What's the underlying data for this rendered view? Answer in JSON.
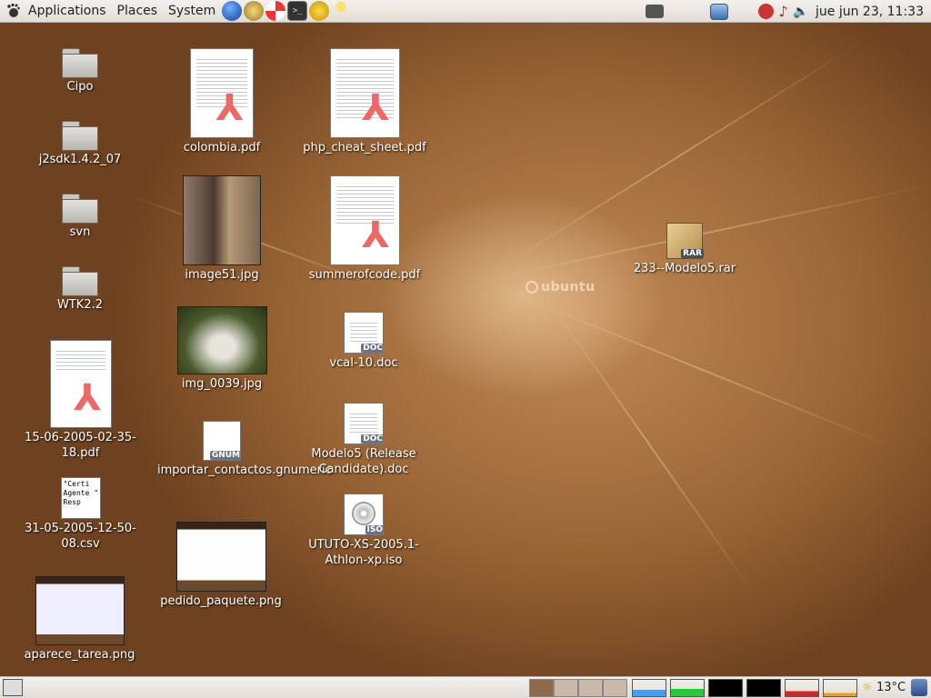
{
  "top_panel": {
    "menus": [
      "Applications",
      "Places",
      "System"
    ],
    "launchers": [
      "globe-icon",
      "network-icon",
      "help-icon",
      "terminal-icon",
      "messenger-icon",
      "gaim-icon"
    ],
    "tray_icons": [
      "screenshot-icon",
      "monitor-icon",
      "stop-icon",
      "music-icon",
      "volume-icon"
    ],
    "clock": "jue jun 23, 11:33"
  },
  "desktop": {
    "watermark": "ubuntu",
    "icons": {
      "cipo": "Cipo",
      "j2sdk": "j2sdk1.4.2_07",
      "svn": "svn",
      "wtk": "WTK2.2",
      "pdf_15_06": "15-06-2005-02-35-18.pdf",
      "csv_31_05": "31-05-2005-12-50-08.csv",
      "csv_preview": "\"Certi Agente \" Resp",
      "aparece": "aparece_tarea.png",
      "colombia": "colombia.pdf",
      "image51": "image51.jpg",
      "img0039": "img_0039.jpg",
      "importar": "importar_contactos.gnumeric",
      "gnum_badge": "GNUM",
      "pedido": "pedido_paquete.png",
      "php": "php_cheat_sheet.pdf",
      "summer": "summerofcode.pdf",
      "vcal": "vcal-10.doc",
      "modelo5_doc": "Modelo5 (Release Candidate).doc",
      "ututo": "UTUTO-XS-2005.1-Athlon-xp.iso",
      "rar": "233--Modelo5.rar",
      "doc_badge": "DOC",
      "iso_badge": "ISO",
      "rar_badge": "RAR"
    }
  },
  "bottom_panel": {
    "weather": "13°C"
  }
}
